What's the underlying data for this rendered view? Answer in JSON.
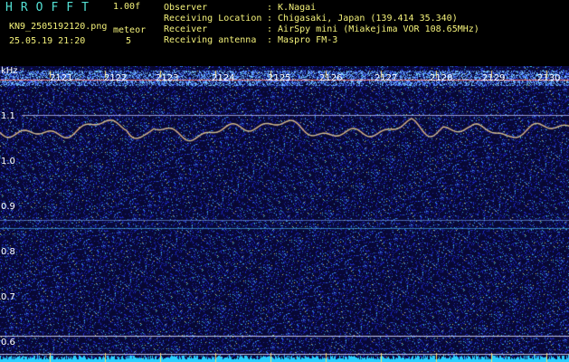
{
  "header": {
    "app_title": "HROFFT",
    "version": "1.00f",
    "filename": "KN9_2505192120.png",
    "mode_label": "meteor",
    "mode_value": "5",
    "datetime": "25.05.19 21:20",
    "info": [
      {
        "label": "Observer",
        "value": ": K.Nagai"
      },
      {
        "label": "Receiving Location",
        "value": ": Chigasaki, Japan (139.414 35.340)"
      },
      {
        "label": "Receiver",
        "value": ": AirSpy mini (Miakejima VOR 108.65MHz)"
      },
      {
        "label": "Receiving antenna",
        "value": ": Maspro FM-3"
      }
    ]
  },
  "spectrogram": {
    "y_unit": "kHz",
    "y_ticks": [
      "1.1",
      "1.0",
      "0.9",
      "0.8",
      "0.7",
      "0.6"
    ],
    "time_ticks": [
      "2121",
      "2122",
      "2123",
      "2124",
      "2125",
      "2126",
      "2127",
      "2128",
      "2129",
      "2130"
    ],
    "colors": {
      "background": "#0a0a3a",
      "trace": "#ff9a66",
      "baseline": "#2ad0ff"
    }
  }
}
